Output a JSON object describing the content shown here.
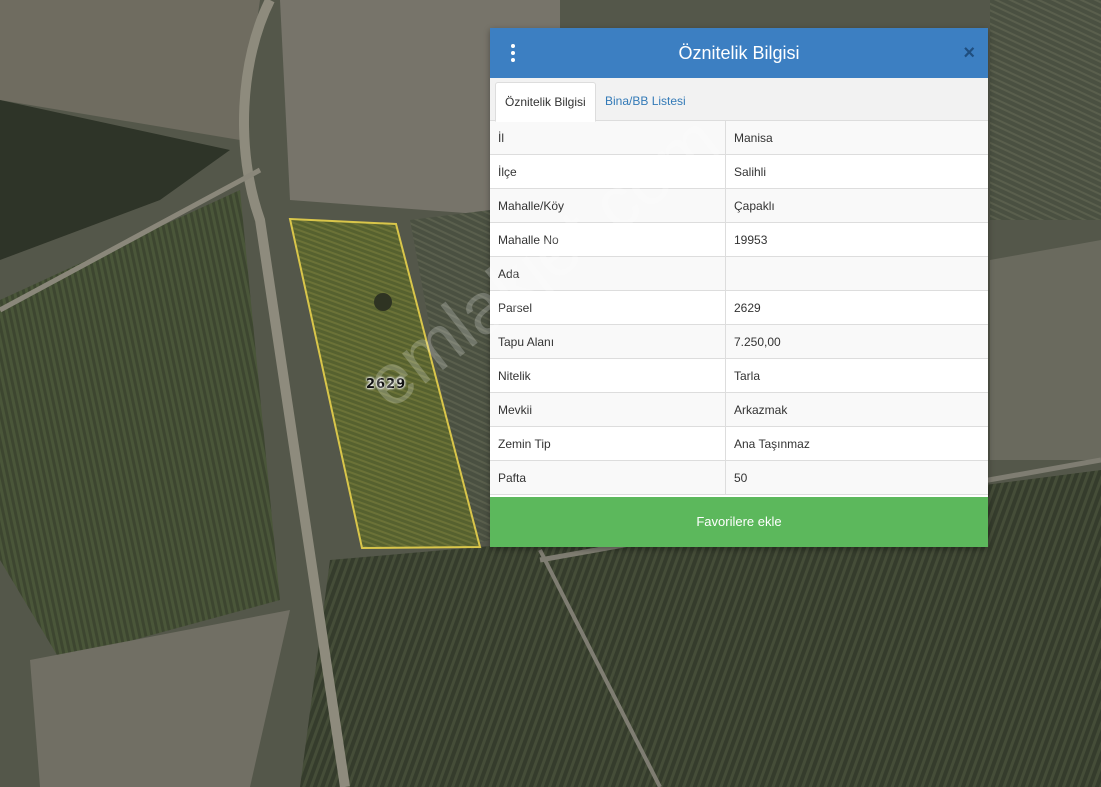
{
  "map": {
    "parcel_label": "2629",
    "watermark": "emlakjet.com"
  },
  "dialog": {
    "title": "Öznitelik Bilgisi",
    "tabs": [
      {
        "label": "Öznitelik Bilgisi",
        "active": true
      },
      {
        "label": "Bina/BB Listesi",
        "active": false
      }
    ],
    "rows": [
      {
        "key": "İl",
        "value": "Manisa"
      },
      {
        "key": "İlçe",
        "value": "Salihli"
      },
      {
        "key": "Mahalle/Köy",
        "value": "Çapaklı"
      },
      {
        "key": "Mahalle No",
        "value": "19953"
      },
      {
        "key": "Ada",
        "value": ""
      },
      {
        "key": "Parsel",
        "value": "2629"
      },
      {
        "key": "Tapu Alanı",
        "value": "7.250,00"
      },
      {
        "key": "Nitelik",
        "value": "Tarla"
      },
      {
        "key": "Mevkii",
        "value": "Arkazmak"
      },
      {
        "key": "Zemin Tip",
        "value": "Ana Taşınmaz"
      },
      {
        "key": "Pafta",
        "value": "50"
      }
    ],
    "favorite_button": "Favorilere ekle",
    "close_icon": "×",
    "menu_icon": "vertical-ellipsis"
  },
  "colors": {
    "header": "#3c7fc2",
    "favorite": "#5cb85c",
    "parcel_outline": "#d9c64a"
  }
}
